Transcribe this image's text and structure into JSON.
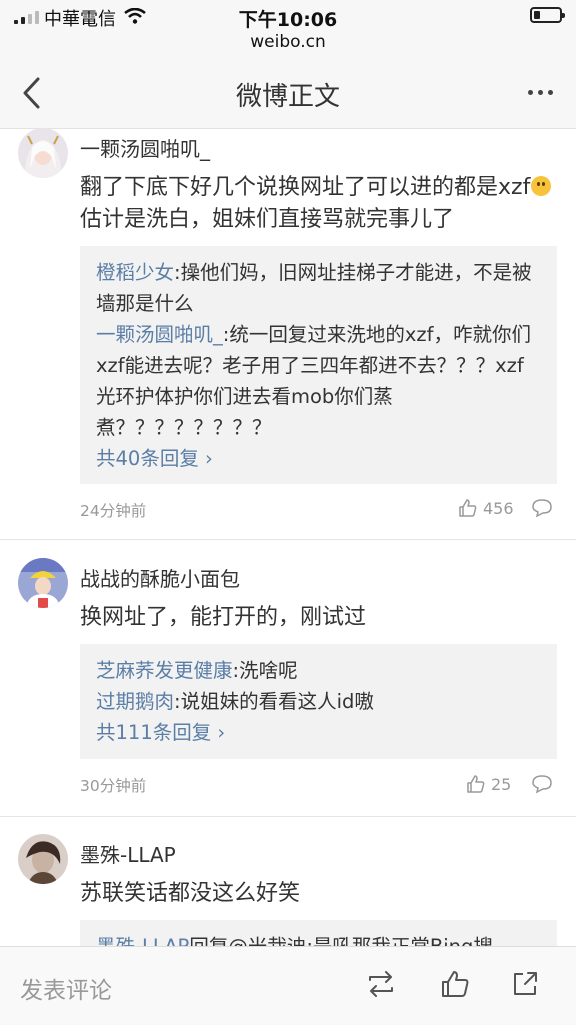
{
  "status_bar": {
    "carrier": "中華電信",
    "time": "下午10:06",
    "url": "weibo.cn",
    "battery_level": 0.25
  },
  "nav": {
    "title": "微博正文",
    "back_icon": "chevron-left-icon",
    "more_icon": "more-dots-icon"
  },
  "comments": [
    {
      "username": "一颗汤圆啪叽_",
      "text_before_emoji": "翻了下底下好几个说换网址了可以进的都是xzf",
      "emoji": "微笑",
      "text_after_emoji": "估计是洗白，姐妹们直接骂就完事儿了",
      "replies": [
        {
          "name": "橙稻少女",
          "text": ":操他们妈，旧网址挂梯子才能进，不是被墙那是什么"
        },
        {
          "name": "一颗汤圆啪叽_",
          "text": ":统一回复过来洗地的xzf，咋就你们xzf能进去呢？老子用了三四年都进不去？？？xzf光环护体护你们进去看mob你们蒸煮？？？？？？？？"
        }
      ],
      "more_replies": "共40条回复",
      "time": "24分钟前",
      "likes": "456"
    },
    {
      "username": "战战的酥脆小面包",
      "text": "换网址了，能打开的，刚试过",
      "replies": [
        {
          "name": "芝麻荞发更健康",
          "text": ":洗啥呢"
        },
        {
          "name": "过期鹅肉",
          "text": ":说姐妹的看看这人id嗷"
        }
      ],
      "more_replies": "共111条回复",
      "time": "30分钟前",
      "likes": "25"
    },
    {
      "username": "墨殊-LLAP",
      "text": "苏联笑话都没这么好笑",
      "replies": [
        {
          "name": "墨殊-LLAP",
          "text": "回复@米栽迪:是吼那我正常Bing搜"
        }
      ]
    }
  ],
  "bottom_bar": {
    "comment_placeholder": "发表评论",
    "repost_icon": "repost-icon",
    "like_icon": "thumbs-up-icon",
    "share_icon": "share-icon"
  }
}
